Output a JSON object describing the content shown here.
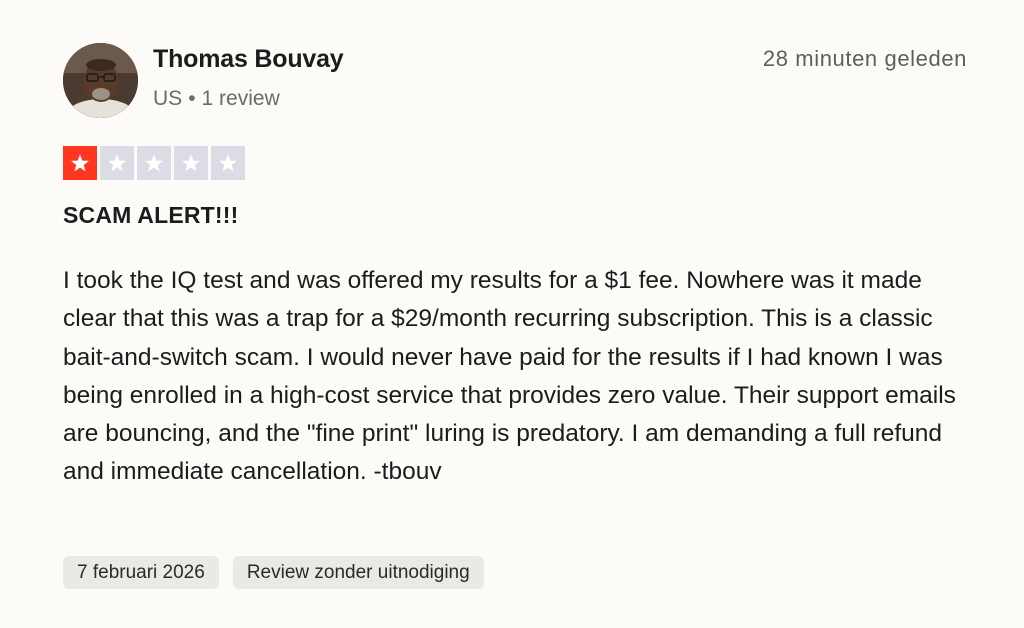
{
  "reviewer": {
    "name": "Thomas Bouvay",
    "country": "US",
    "separator": "•",
    "review_count": "1 review"
  },
  "review": {
    "timestamp": "28 minuten geleden",
    "rating": 1,
    "rating_max": 5,
    "rating_color": "#ff3722",
    "empty_star_color": "#dcdce6",
    "title": "SCAM ALERT!!!",
    "text": "I took the IQ test and was offered my results for a $1 fee. Nowhere was it made clear that this was a trap for a $29/month recurring subscription. This is a classic bait-and-switch scam. I would never have paid for the results if I had known I was being enrolled in a high-cost service that provides zero value. Their support emails are bouncing, and the \"fine print\" luring is predatory. I am demanding a full refund and immediate cancellation. -tbouv"
  },
  "tags": {
    "date": "7 februari 2026",
    "invitation": "Review zonder uitnodiging"
  }
}
